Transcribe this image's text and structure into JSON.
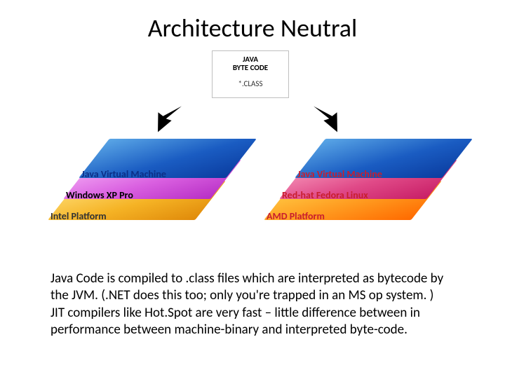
{
  "title": "Architecture Neutral",
  "bytecode": {
    "line1": "JAVA",
    "line2": "BYTE CODE",
    "line3": "*.CLASS"
  },
  "left_stack": {
    "jvm": "Java Virtual Machine",
    "os": "Windows XP Pro",
    "hw": "Intel Platform"
  },
  "right_stack": {
    "jvm": "Java Virtual Machine",
    "os": "Red-hat Fedora Linux",
    "hw": "AMD Platform"
  },
  "paragraph": "Java Code is compiled to .class files which are interpreted as bytecode by the JVM. (.NET does this too; only you're trapped in an MS op system. )\nJIT compilers like Hot.Spot are very fast – little difference between in performance between machine-binary and interpreted byte-code."
}
